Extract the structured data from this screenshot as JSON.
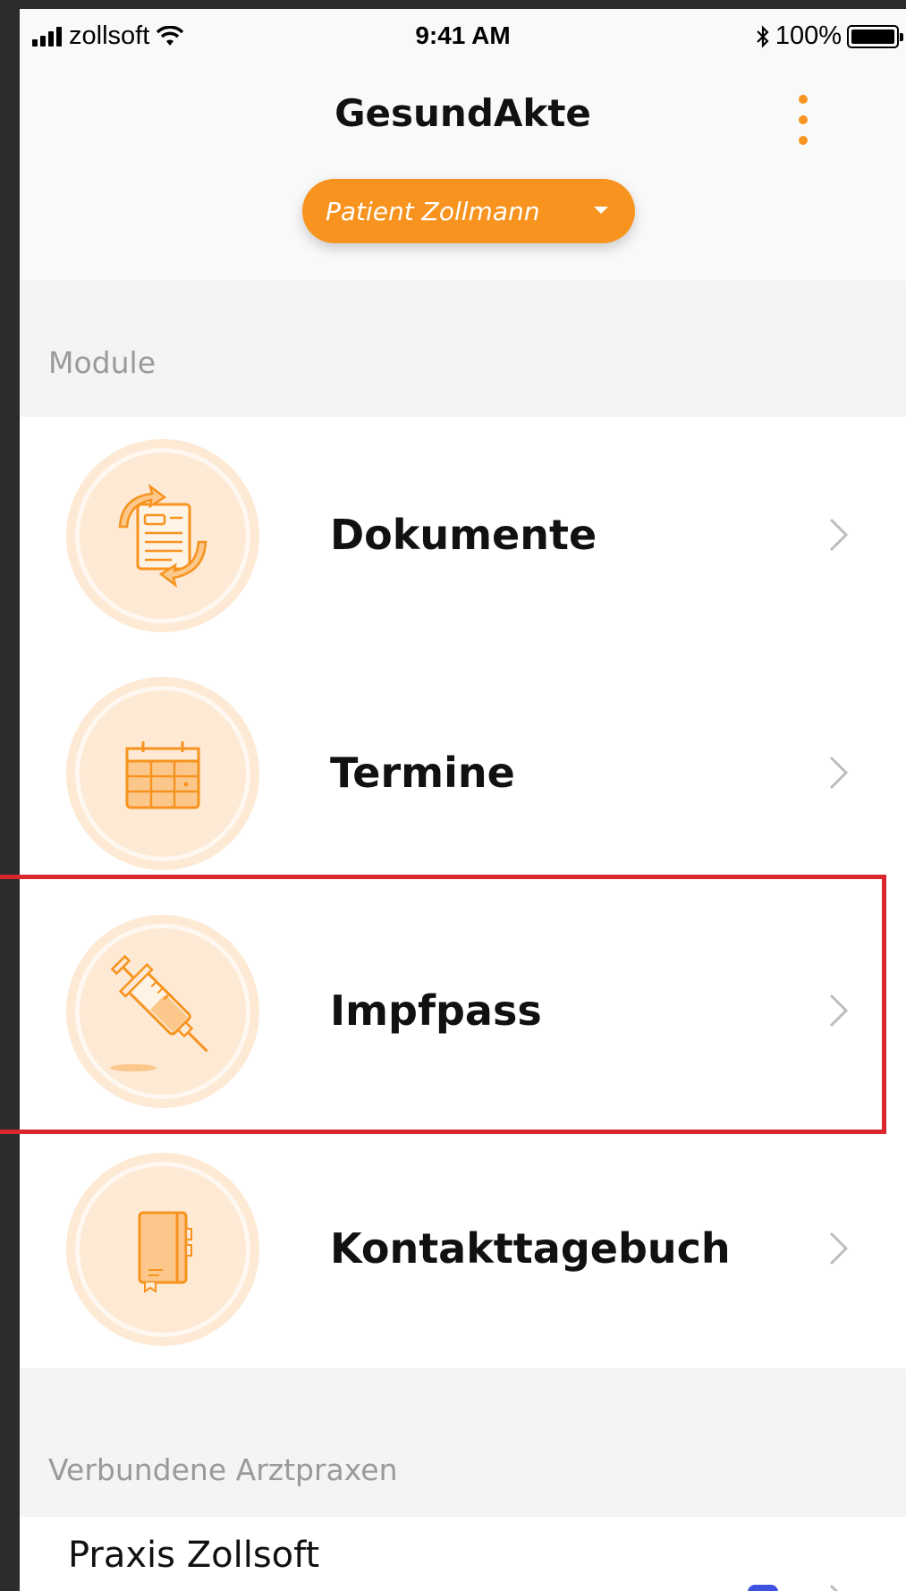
{
  "status_bar": {
    "carrier": "zollsoft",
    "time": "9:41 AM",
    "battery": "100%"
  },
  "header": {
    "title": "GesundAkte",
    "patient_selector": "Patient Zollmann"
  },
  "sections": {
    "modules_label": "Module",
    "practices_label": "Verbundene Arztpraxen"
  },
  "modules": [
    {
      "label": "Dokumente",
      "icon": "document-exchange-icon"
    },
    {
      "label": "Termine",
      "icon": "calendar-icon"
    },
    {
      "label": "Impfpass",
      "icon": "syringe-icon"
    },
    {
      "label": "Kontakttagebuch",
      "icon": "notebook-icon"
    }
  ],
  "practices": [
    {
      "name": "Praxis Zollsoft"
    }
  ],
  "colors": {
    "accent": "#f7931e",
    "icon_bg": "#fde9d4",
    "highlight": "#d9262f"
  }
}
